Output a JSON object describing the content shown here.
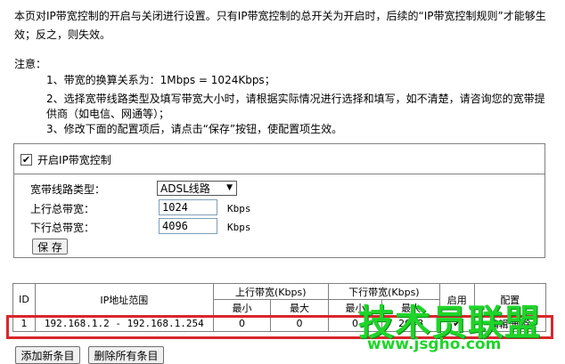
{
  "intro": "本页对IP带宽控制的开启与关闭进行设置。只有IP带宽控制的总开关为开启时，后续的“IP带宽控制规则”才能够生效；反之，则失效。",
  "note_title": "注意：",
  "notes": [
    "1、带宽的换算关系为：1Mbps = 1024Kbps；",
    "2、选择宽带线路类型及填写带宽大小时，请根据实际情况进行选择和填写，如不清楚，请咨询您的宽带提",
    "供商（如电信、网通等）；",
    "3、修改下面的配置项后，请点击“保存”按钮，使配置项生效。"
  ],
  "enable": {
    "label": "开启IP带宽控制",
    "checked": "✔"
  },
  "form": {
    "line_type_label": "宽带线路类型：",
    "line_type_value": "ADSL线路",
    "line_type_arrow": "▼",
    "up_label": "上行总带宽：",
    "up_value": "1024",
    "down_label": "下行总带宽：",
    "down_value": "4096",
    "unit": "Kbps",
    "save": "保 存"
  },
  "table": {
    "h_id": "ID",
    "h_ip": "IP地址范围",
    "h_up": "上行带宽(Kbps)",
    "h_down": "下行带宽(Kbps)",
    "h_enable": "启用",
    "h_config": "配置",
    "h_min": "最小",
    "h_max": "最大",
    "rows": [
      {
        "id": "1",
        "ip": "192.168.1.2 - 192.168.1.254",
        "up_min": "0",
        "up_max": "0",
        "down_min": "0",
        "down_max": "2048",
        "enable": "✔",
        "config": "编辑 删除"
      }
    ]
  },
  "buttons": {
    "add": "添加新条目",
    "delete_all": "删除所有条目"
  },
  "watermark": {
    "logo": "技术员联盟",
    "url": "www.jsgho.com",
    "color": "#1fd42a"
  }
}
